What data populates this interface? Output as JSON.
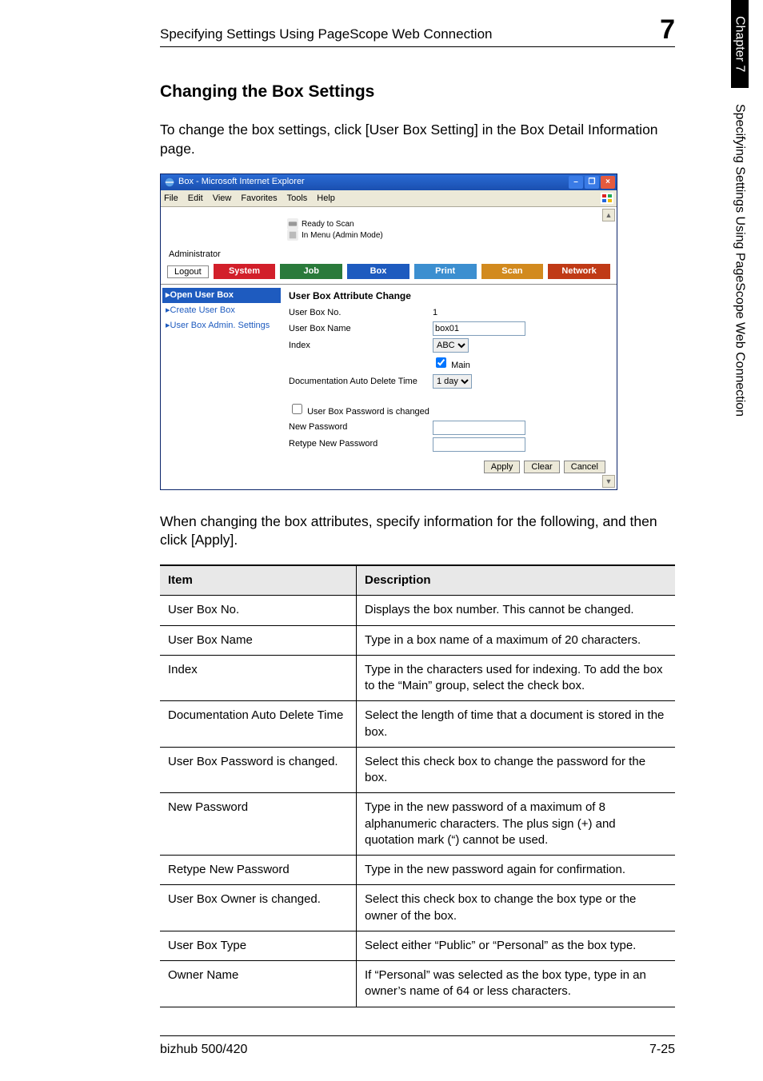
{
  "sidebar": {
    "chapter": "Chapter 7",
    "section": "Specifying Settings Using PageScope Web Connection"
  },
  "header": {
    "left": "Specifying Settings Using PageScope Web Connection",
    "right": "7"
  },
  "section_title": "Changing the Box Settings",
  "intro_paragraph": "To change the box settings, click [User Box Setting] in the Box Detail Information page.",
  "after_shot_paragraph": "When changing the box attributes, specify information for the following, and then click [Apply].",
  "footer": {
    "left": "bizhub 500/420",
    "right": "7-25"
  },
  "screenshot": {
    "title": "Box - Microsoft Internet Explorer",
    "menubar": [
      "File",
      "Edit",
      "View",
      "Favorites",
      "Tools",
      "Help"
    ],
    "brand_lines": [
      "Ready to Scan",
      "In Menu (Admin Mode)"
    ],
    "admin_label": "Administrator",
    "logout_label": "Logout",
    "tabs": {
      "system": "System",
      "job": "Job",
      "box": "Box",
      "print": "Print",
      "scan": "Scan",
      "network": "Network"
    },
    "nav": {
      "open": "Open User Box",
      "create": "Create User Box",
      "admin": "User Box Admin. Settings"
    },
    "form": {
      "title": "User Box Attribute Change",
      "rows": {
        "box_no_label": "User Box No.",
        "box_no_value": "1",
        "box_name_label": "User Box Name",
        "box_name_value": "box01",
        "index_label": "Index",
        "index_value": "ABC",
        "main_label": "Main",
        "autodel_label": "Documentation Auto Delete Time",
        "autodel_value": "1 day",
        "pw_changed_label": "User Box Password is changed",
        "new_pw_label": "New Password",
        "retype_pw_label": "Retype New Password"
      },
      "buttons": {
        "apply": "Apply",
        "clear": "Clear",
        "cancel": "Cancel"
      }
    }
  },
  "table": {
    "head_item": "Item",
    "head_desc": "Description",
    "rows": [
      {
        "item": "User Box No.",
        "desc": "Displays the box number. This cannot be changed."
      },
      {
        "item": "User Box Name",
        "desc": "Type in a box name of a maximum of 20 characters."
      },
      {
        "item": "Index",
        "desc": "Type in the characters used for indexing. To add the box to the “Main” group, select the check box."
      },
      {
        "item": "Documentation Auto Delete Time",
        "desc": "Select the length of time that a document is stored in the box."
      },
      {
        "item": "User Box Password is changed.",
        "desc": "Select this check box to change the password for the box."
      },
      {
        "item": "New Password",
        "desc": "Type in the new password of a maximum of 8 alphanumeric characters. The plus sign (+) and quotation mark (“) cannot be used."
      },
      {
        "item": "Retype New Password",
        "desc": "Type in the new password again for confirmation."
      },
      {
        "item": "User Box Owner is changed.",
        "desc": "Select this check box to change the box type or the owner of the box."
      },
      {
        "item": "User Box Type",
        "desc": "Select either “Public” or “Personal” as the box type."
      },
      {
        "item": "Owner Name",
        "desc": "If “Personal” was selected as the box type, type in an owner’s name of 64 or less characters."
      }
    ]
  }
}
